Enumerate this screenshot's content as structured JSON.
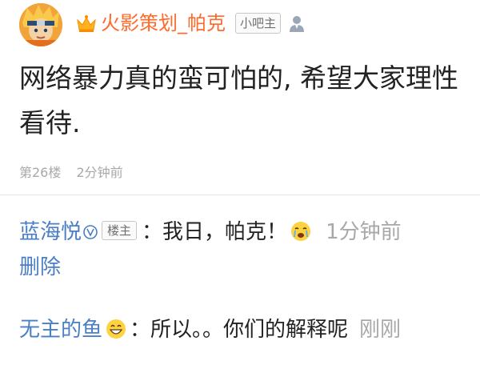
{
  "post": {
    "author": "火影策划_帕克",
    "role_badge": "小吧主",
    "text": "网络暴力真的蛮可怕的, 希望大家理性看待.",
    "floor": "第26楼",
    "time": "2分钟前",
    "icons": {
      "avatar": "avatar-image",
      "crown": "crown-icon",
      "user": "user-icon"
    },
    "colors": {
      "author": "#ff6a2b"
    }
  },
  "replies": [
    {
      "author": "蓝海悦",
      "badge": "楼主",
      "colon": "：",
      "text": "我日，帕克！",
      "emoji": "crying-emoji",
      "time": "1分钟前",
      "action": "删除"
    },
    {
      "author": "无主的鱼",
      "colon": "：",
      "text": "所以。。你们的解释呢",
      "emoji": "grin-emoji",
      "time": "刚刚"
    }
  ],
  "colors": {
    "link": "#4a7ec6",
    "meta": "#a8a8a8"
  }
}
